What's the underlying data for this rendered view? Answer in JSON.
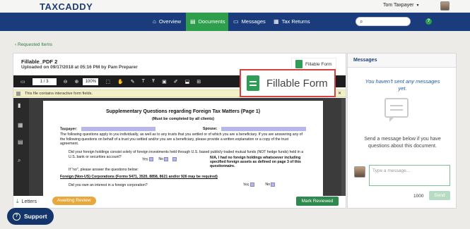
{
  "app": {
    "logo": "TAXCADDY",
    "user_name": "Tom Taxpayer"
  },
  "nav": {
    "items": [
      {
        "label": "Overview",
        "icon": "home-icon"
      },
      {
        "label": "Documents",
        "icon": "document-icon"
      },
      {
        "label": "Messages",
        "icon": "message-icon"
      },
      {
        "label": "Tax Returns",
        "icon": "tax-return-icon"
      }
    ],
    "active": "Documents",
    "help": "?"
  },
  "breadcrumb": {
    "back": "Requested Items"
  },
  "document": {
    "title": "Fillable_PDF 2",
    "uploaded": "Uploaded on 09/17/2018 at 05:16 PM by Pam Preparer",
    "fillable_label": "Fillable Form",
    "page_indicator": "1 / 3",
    "zoom": "100%",
    "notice": "This file contains interactive form fields."
  },
  "form": {
    "title": "Supplementary Questions regarding Foreign Tax Matters (Page 1)",
    "subtitle": "(Must be completed by all clients)",
    "taxpayer_label": "Taxpayer:",
    "spouse_label": "Spouse:",
    "intro": "The following questions apply to you individually, as well as to any trusts that you settled or of which you are a beneficiary. If you are answering any of the following questions on behalf of a trust you settled and/or you are a beneficiary, please provide a written explanation or a copy of the trust agreement.",
    "q1": "Did your foreign holdings consist solely of foreign investments held through U.S. based publicly traded mutual funds (NOT hedge funds) held in a U.S. bank or securities account?",
    "yes": "Yes",
    "no": "No",
    "na": "N/A, I had no foreign holdings whatsoever including specified foreign assets as defined on page 3 of this questionnaire.",
    "if_no": "If \"no\", please answer the questions below:",
    "section": "Foreign (Non-US) Corporations (Forms 5471, 3520, 8858, 8621 and/or 926 may be required)",
    "q2": "Did you own an interest in a foreign corporation?"
  },
  "footer": {
    "letters": "Letters",
    "status": "Awaiting Review",
    "mark_button": "Mark Reviewed"
  },
  "messages": {
    "header": "Messages",
    "empty": "You haven't sent any messages yet.",
    "help": "Send a message below if you have questions about this document.",
    "placeholder": "Type a message...",
    "count": "1000",
    "send": "Send"
  },
  "support": {
    "label": "Support"
  },
  "colors": {
    "nav": "#1a3c7c",
    "accent": "#2d9e4b",
    "status": "#e9a83c",
    "callout_border": "#d94040"
  }
}
